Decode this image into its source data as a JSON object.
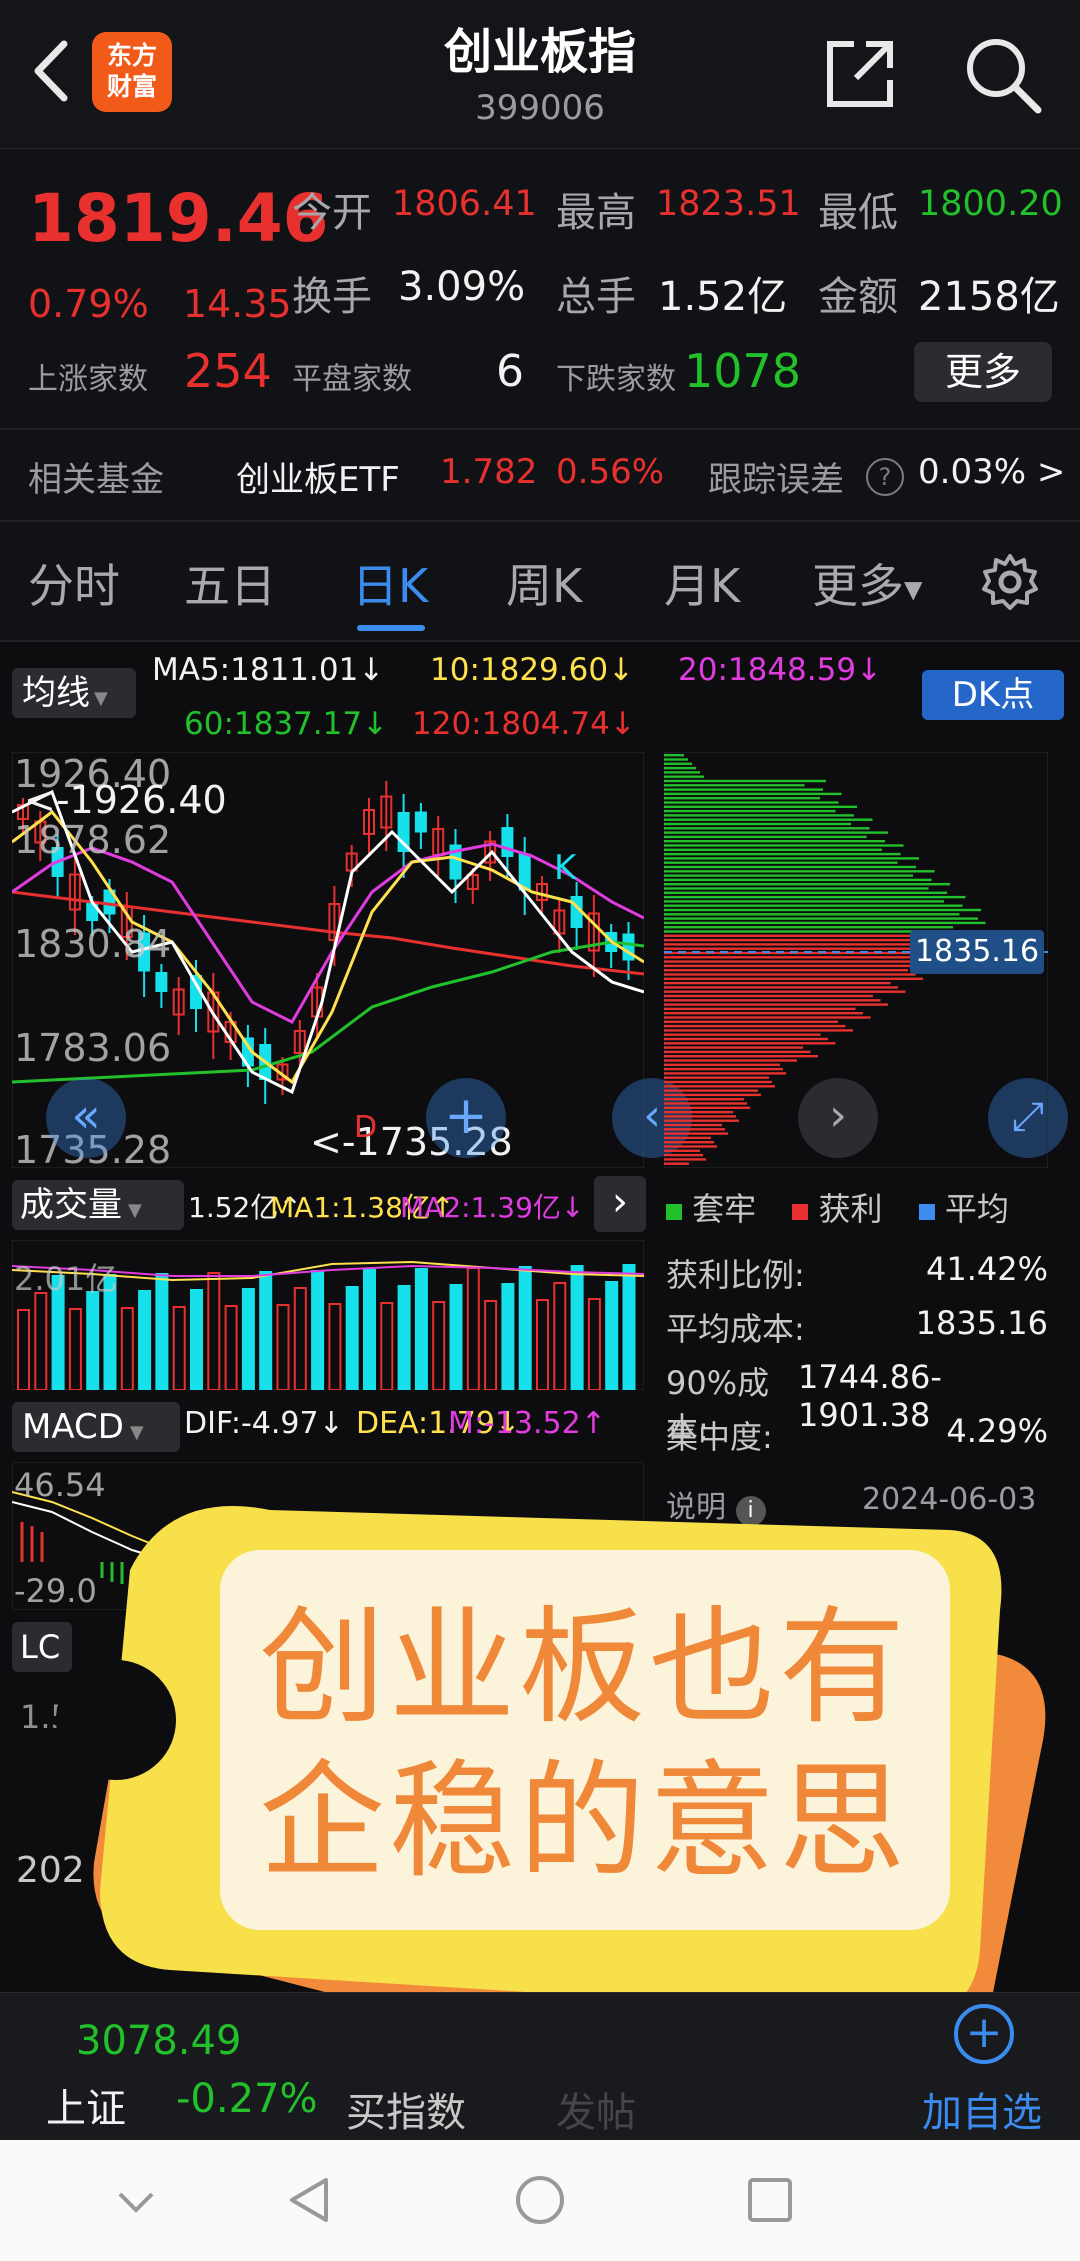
{
  "header": {
    "logo_line1": "东方",
    "logo_line2": "财富",
    "title": "创业板指",
    "code": "399006"
  },
  "quote": {
    "price": "1819.46",
    "change_pct": "0.79%",
    "change_val": "14.35",
    "open_label": "今开",
    "open_value": "1806.41",
    "high_label": "最高",
    "high_value": "1823.51",
    "low_label": "最低",
    "low_value": "1800.20",
    "turnover_label": "换手",
    "turnover_value": "3.09%",
    "volume_label": "总手",
    "volume_value": "1.52亿",
    "amount_label": "金额",
    "amount_value": "2158亿",
    "up_label": "上涨家数",
    "up_value": "254",
    "flat_label": "平盘家数",
    "flat_value": "6",
    "down_label": "下跌家数",
    "down_value": "1078",
    "more_label": "更多"
  },
  "fund": {
    "label": "相关基金",
    "name": "创业板ETF",
    "price": "1.782",
    "pct": "0.56%",
    "track_label": "跟踪误差",
    "track_value": "0.03% >"
  },
  "tabs": [
    "分时",
    "五日",
    "日K",
    "周K",
    "月K",
    "更多"
  ],
  "ma": {
    "selector": "均线",
    "ma5": "MA5:1811.01↓",
    "ma10": "10:1829.60↓",
    "ma20": "20:1848.59↓",
    "ma60": "60:1837.17↓",
    "ma120": "120:1804.74↓",
    "dk_button": "DK点"
  },
  "kline": {
    "y_labels": [
      "1926.40",
      "1878.62",
      "1830.84",
      "1783.06",
      "1735.28"
    ],
    "high_marker": "<-1926.40",
    "low_marker": "<-1735.28",
    "k_marker": "K",
    "d_marker": "D"
  },
  "chip": {
    "price_tag": "1835.16",
    "legend": [
      "套牢",
      "获利",
      "平均"
    ],
    "rows": [
      {
        "label": "获利比例:",
        "value": "41.42%"
      },
      {
        "label": "平均成本:",
        "value": "1835.16"
      },
      {
        "label": "90%成本:",
        "value": "1744.86-1901.38"
      },
      {
        "label": "集中度:",
        "value": "4.29%"
      }
    ],
    "note_label": "说明",
    "date": "2024-06-03"
  },
  "volume": {
    "selector": "成交量",
    "vol": "1.52亿↑",
    "ma1": "MA1:1.38亿↑",
    "ma2": "MA2:1.39亿↓",
    "axis": "2.01亿"
  },
  "macd": {
    "selector": "MACD",
    "dif": "DIF:-4.97↓",
    "dea": "DEA:1.79↓",
    "m": "M:-13.52↑",
    "axis_top": "46.54",
    "axis_bottom": "-29.0"
  },
  "lower": {
    "selector": "LC",
    "axis": "1.54万",
    "year": "202"
  },
  "overlay": {
    "line1": "创业板也有",
    "line2": "企稳的意思"
  },
  "bottom": {
    "index_value": "3078.49",
    "index_name": "上证",
    "index_pct": "-0.27%",
    "buy_label": "买指数",
    "hidden_label": "发帖",
    "add_label": "加自选"
  },
  "colors": {
    "up": "#e8312f",
    "down": "#22c02a",
    "accent": "#3c8cf0",
    "ma5": "#ffffff",
    "ma10": "#ffe14d",
    "ma20": "#e03ce0",
    "ma60": "#22c02a",
    "ma120": "#e8312f",
    "bar_down": "#16e0ea"
  }
}
